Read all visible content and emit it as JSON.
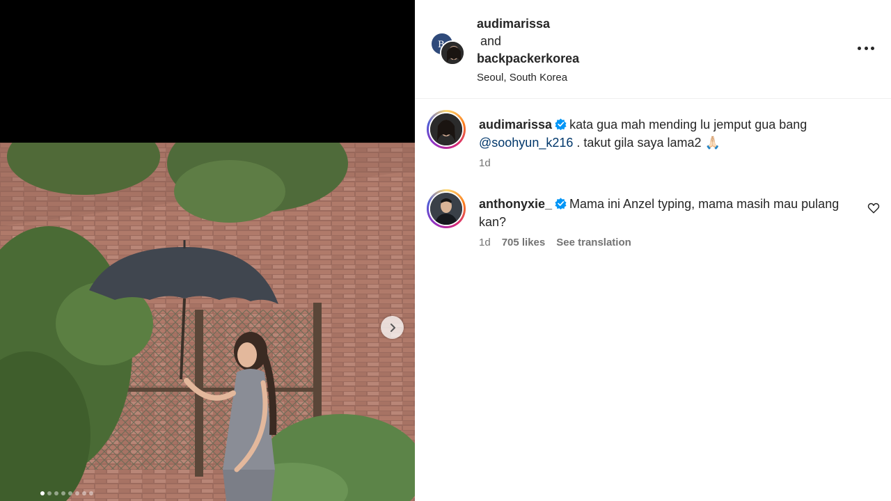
{
  "post": {
    "slide_count": 8,
    "active_slide": 0
  },
  "header": {
    "user1": "audimarissa",
    "and_text": "and",
    "user2": "backpackerkorea",
    "location": "Seoul, South Korea"
  },
  "comments": [
    {
      "username": "audimarissa",
      "text_before": "kata gua mah mending lu jemput gua bang",
      "mention": "@soohyun_k216",
      "text_after": ". takut gila saya lama2 🙏🏻",
      "time": "1d"
    },
    {
      "username": "anthonyxie_",
      "text": "Mama ini Anzel typing, mama masih mau pulang kan?",
      "time": "1d",
      "likes": "705 likes",
      "see_translation": "See translation"
    }
  ],
  "colors": {
    "verified": "#0095f6",
    "mention": "#00376b",
    "meta": "#737373"
  },
  "icons": {
    "more": "more-horizontal-icon",
    "next": "chevron-right-icon",
    "verified": "verified-badge-icon",
    "like": "heart-outline-icon"
  }
}
